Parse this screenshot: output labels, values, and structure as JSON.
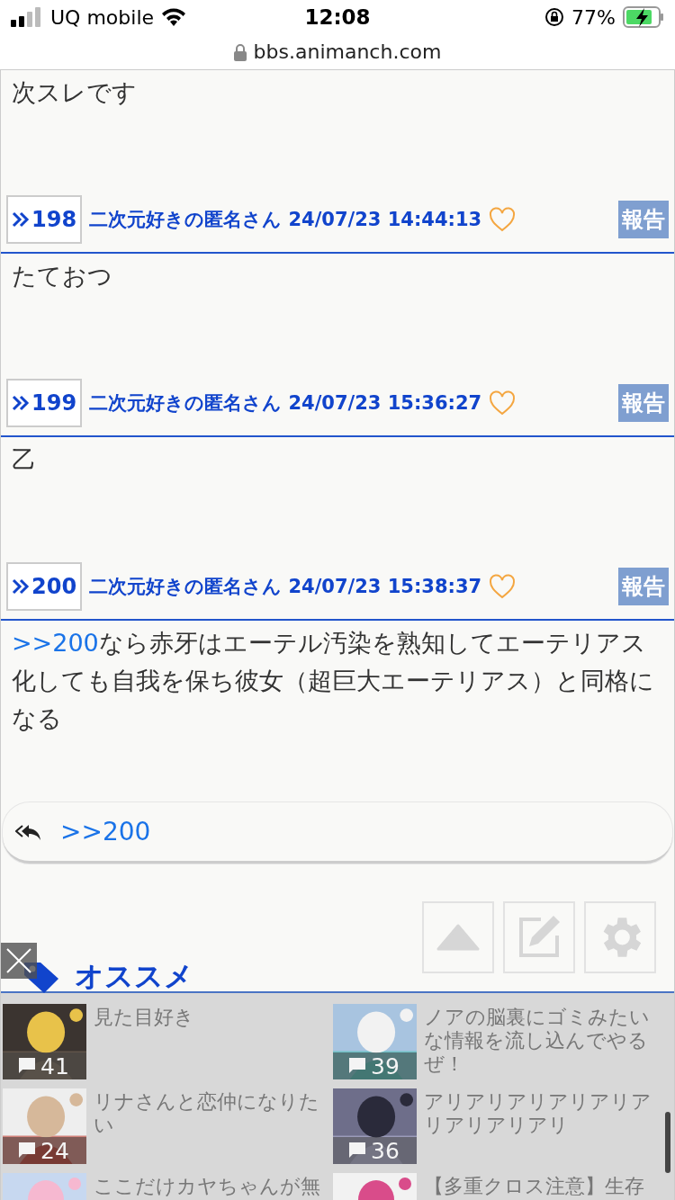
{
  "status_bar": {
    "carrier": "UQ mobile",
    "time": "12:08",
    "battery": "77%"
  },
  "url_bar": {
    "domain": "bbs.animanch.com"
  },
  "posts": [
    {
      "body": "次スレです"
    },
    {
      "header": {
        "number": "198",
        "author": "二次元好きの匿名さん 24/07/23 14:44:13",
        "report": "報告",
        "liked": false
      },
      "body": "たておつ"
    },
    {
      "header": {
        "number": "199",
        "author": "二次元好きの匿名さん 24/07/23 15:36:27",
        "report": "報告",
        "liked": false
      },
      "body": "乙"
    },
    {
      "header": {
        "number": "200",
        "author": "二次元好きの匿名さん 24/07/23 15:38:37",
        "report": "報告",
        "liked": false
      },
      "anchor": ">>200",
      "body": "なら赤牙はエーテル汚染を熟知してエーテリアス化しても自我を保ち彼女（超巨大エーテリアス）と同格になる"
    }
  ],
  "reply_bar": {
    "link": ">>200"
  },
  "recommend": {
    "title": "オススメ",
    "items": [
      {
        "title": "見た目好き",
        "count": "41"
      },
      {
        "title": "ノアの脳裏にゴミみたいな情報を流し込んでやるぜ！",
        "count": "39"
      },
      {
        "title": "リナさんと恋仲になりたい",
        "count": "24"
      },
      {
        "title": "アリアリアリアリアリアリアリアリアリ",
        "count": "36"
      },
      {
        "title": "ここだけカヤちゃんが無"
      },
      {
        "title": "【多重クロス注意】生存"
      }
    ]
  }
}
